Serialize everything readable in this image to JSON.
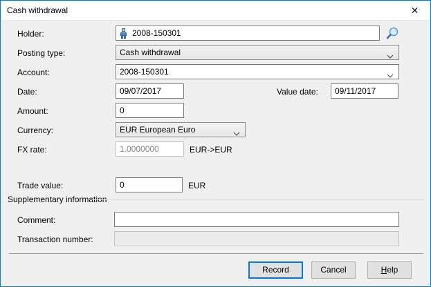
{
  "window": {
    "title": "Cash withdrawal",
    "accent_color": "#0078d7",
    "icons": {
      "close": "✕",
      "search": "magnifier-icon",
      "holder": "person-icon",
      "dropdown": "chevron-down-icon"
    }
  },
  "fields": {
    "holder": {
      "label": "Holder:",
      "value": "2008-150301"
    },
    "posting_type": {
      "label": "Posting type:",
      "value": "Cash withdrawal"
    },
    "account": {
      "label": "Account:",
      "value": "2008-150301"
    },
    "date": {
      "label": "Date:",
      "value": "09/07/2017"
    },
    "value_date": {
      "label": "Value date:",
      "value": "09/11/2017"
    },
    "amount": {
      "label": "Amount:",
      "value": "0"
    },
    "currency": {
      "label": "Currency:",
      "value": "EUR European Euro"
    },
    "fx_rate": {
      "label": "FX rate:",
      "value": "1.0000000",
      "suffix": "EUR->EUR"
    },
    "trade_value": {
      "label": "Trade value:",
      "value": "0",
      "suffix": "EUR"
    },
    "comment": {
      "label": "Comment:",
      "value": ""
    },
    "transaction_number": {
      "label": "Transaction number:",
      "value": ""
    }
  },
  "sections": {
    "supplementary": "Supplementary information"
  },
  "buttons": {
    "record": "Record",
    "cancel": "Cancel",
    "help": "Help"
  }
}
